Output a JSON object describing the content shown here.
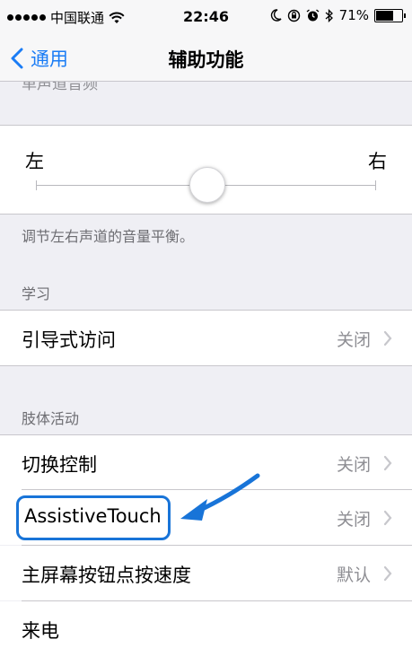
{
  "status_bar": {
    "carrier": "中国联通",
    "time": "22:46",
    "battery": "71%",
    "battery_level": 0.71,
    "icons": [
      "signal-dots",
      "wifi-icon",
      "moon-icon",
      "orientation-lock-icon",
      "alarm-icon",
      "bluetooth-icon",
      "battery-icon"
    ]
  },
  "nav": {
    "back_label": "通用",
    "title": "辅助功能"
  },
  "balance": {
    "partial_text": "单声道音频",
    "left_label": "左",
    "right_label": "右",
    "value": 0.5,
    "footer": "调节左右声道的音量平衡。"
  },
  "learning": {
    "header": "学习",
    "rows": [
      {
        "label": "引导式访问",
        "value": "关闭"
      }
    ]
  },
  "physical": {
    "header": "肢体活动",
    "rows": [
      {
        "label": "切换控制",
        "value": "关闭"
      },
      {
        "label": "AssistiveTouch",
        "value": "关闭"
      },
      {
        "label": "主屏幕按钮点按速度",
        "value": "默认"
      },
      {
        "label": "来电",
        "value": ""
      }
    ]
  },
  "colors": {
    "accent": "#1a7cf5",
    "annotation": "#1874d8",
    "background": "#efeff4"
  }
}
